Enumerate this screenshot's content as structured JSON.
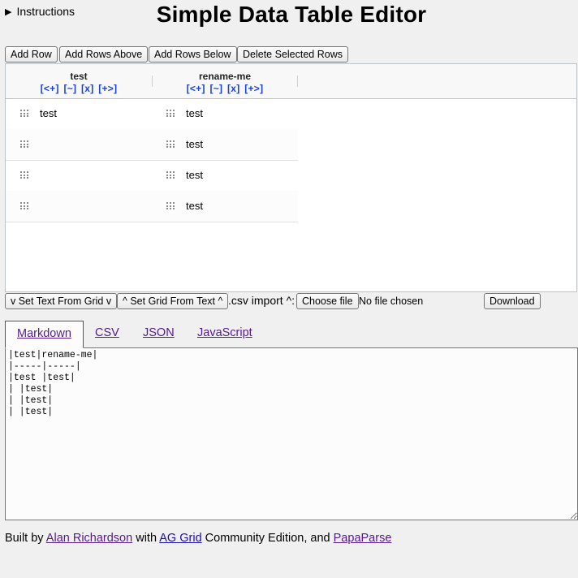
{
  "instructions_label": "Instructions",
  "title": "Simple Data Table Editor",
  "toolbar": {
    "add_row": "Add Row",
    "add_rows_above": "Add Rows Above",
    "add_rows_below": "Add Rows Below",
    "delete_selected": "Delete Selected Rows"
  },
  "grid": {
    "columns": [
      {
        "name": "test",
        "controls": [
          "[<+]",
          "[~]",
          "[x]",
          "[+>]"
        ]
      },
      {
        "name": "rename-me",
        "controls": [
          "[<+]",
          "[~]",
          "[x]",
          "[+>]"
        ]
      }
    ],
    "rows": [
      [
        "test",
        "test"
      ],
      [
        "",
        "test"
      ],
      [
        "",
        "test"
      ],
      [
        "",
        "test"
      ]
    ]
  },
  "controls": {
    "set_text_from_grid": "v Set Text From Grid v",
    "set_grid_from_text": "^ Set Grid From Text ^",
    "csv_import_label": ".csv import ^:",
    "choose_file": "Choose file",
    "no_file": "No file chosen",
    "download": "Download"
  },
  "tabs": [
    "Markdown",
    "CSV",
    "JSON",
    "JavaScript"
  ],
  "active_tab": "Markdown",
  "text_output": "|test|rename-me|\n|-----|-----|\n|test |test|\n| |test|\n| |test|\n| |test|",
  "footer": {
    "built_by": "Built by",
    "author": "Alan Richardson",
    "with": "with",
    "grid_lib": "AG Grid",
    "edition": "Community Edition, and",
    "parser": "PapaParse"
  },
  "colors": {
    "column_controls": "#1a3fd6",
    "visited_link": "#551a8b",
    "link": "#1a0dab",
    "background": "#f0f0f0"
  }
}
